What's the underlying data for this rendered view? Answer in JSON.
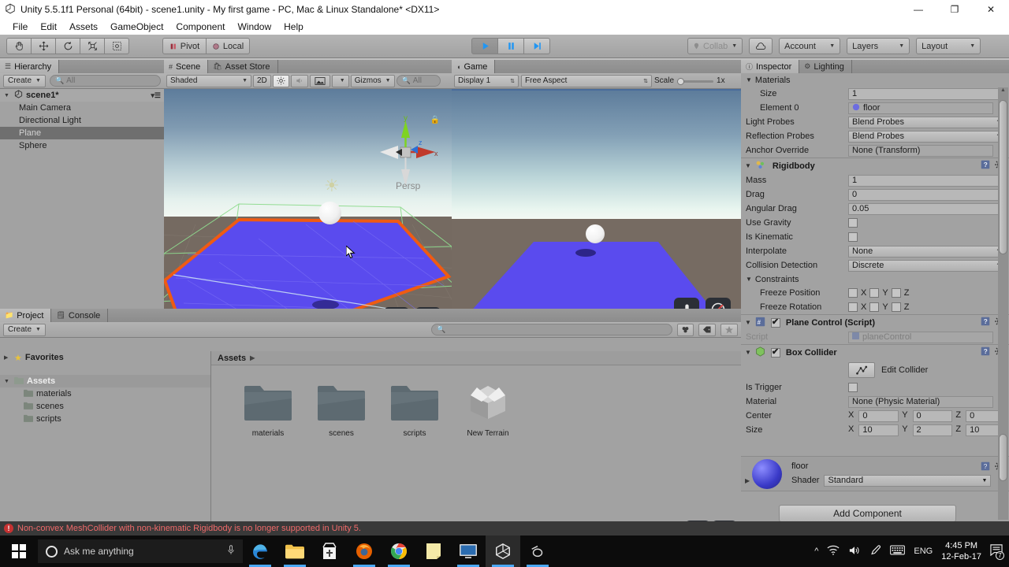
{
  "window": {
    "title": "Unity 5.5.1f1 Personal (64bit) - scene1.unity - My first game - PC, Mac & Linux Standalone* <DX11>",
    "app_icon": "unity-icon",
    "minimize": "—",
    "maximize": "❐",
    "close": "✕"
  },
  "menu": {
    "items": [
      "File",
      "Edit",
      "Assets",
      "GameObject",
      "Component",
      "Window",
      "Help"
    ]
  },
  "toolbar": {
    "transform_tools": [
      "hand-tool",
      "move-tool",
      "rotate-tool",
      "scale-tool",
      "rect-tool"
    ],
    "pivot_label": "Pivot",
    "local_label": "Local",
    "play_label": "play-button",
    "pause_label": "pause-button",
    "step_label": "step-button",
    "collab_label": "Collab",
    "cloud_label": "cloud-icon",
    "account_label": "Account",
    "layers_label": "Layers",
    "layout_label": "Layout"
  },
  "hierarchy": {
    "tab_label": "Hierarchy",
    "create_label": "Create",
    "search_placeholder": "All",
    "scene_name": "scene1*",
    "items": [
      {
        "label": "Main Camera",
        "selected": false
      },
      {
        "label": "Directional Light",
        "selected": false
      },
      {
        "label": "Plane",
        "selected": true
      },
      {
        "label": "Sphere",
        "selected": false
      }
    ]
  },
  "scene_view": {
    "tabs": [
      {
        "label": "Scene",
        "icon": "grid-icon",
        "active": true
      },
      {
        "label": "Asset Store",
        "icon": "store-icon",
        "active": false
      }
    ],
    "shading_mode": "Shaded",
    "mode_2d": "2D",
    "lighting_toggle": "sun-icon",
    "audio_toggle": "speaker-icon",
    "effects_toggle": "image-icon",
    "gizmos_label": "Gizmos",
    "search_placeholder": "All",
    "gizmo_axes": {
      "y": "y",
      "z": "z",
      "x": "x"
    },
    "projection_label": "Persp"
  },
  "game_view": {
    "tab_label": "Game",
    "display_label": "Display 1",
    "aspect_label": "Free Aspect",
    "scale_label": "Scale",
    "scale_value": "1x"
  },
  "project": {
    "tabs": [
      {
        "label": "Project",
        "icon": "folder-icon",
        "active": true
      },
      {
        "label": "Console",
        "icon": "console-icon",
        "active": false
      }
    ],
    "create_label": "Create",
    "search_placeholder": "",
    "tree": [
      {
        "label": "Favorites",
        "type": "favorites",
        "expanded": false
      },
      {
        "label": "Assets",
        "type": "folder",
        "selected": true,
        "expanded": true
      },
      {
        "label": "materials",
        "type": "folder",
        "indent": 2
      },
      {
        "label": "scenes",
        "type": "folder",
        "indent": 2
      },
      {
        "label": "scripts",
        "type": "folder",
        "indent": 2
      }
    ],
    "breadcrumb": "Assets",
    "assets": [
      {
        "label": "materials",
        "type": "folder"
      },
      {
        "label": "scenes",
        "type": "folder"
      },
      {
        "label": "scripts",
        "type": "folder"
      },
      {
        "label": "New Terrain",
        "type": "package"
      }
    ]
  },
  "inspector": {
    "tabs": [
      {
        "label": "Inspector",
        "icon": "info-icon",
        "active": true
      },
      {
        "label": "Lighting",
        "icon": "lighting-icon",
        "active": false
      }
    ],
    "materials": {
      "header": "Materials",
      "size_label": "Size",
      "size_value": "1",
      "element_label": "Element 0",
      "element_value": "floor",
      "light_probes_label": "Light Probes",
      "light_probes_value": "Blend Probes",
      "reflection_probes_label": "Reflection Probes",
      "reflection_probes_value": "Blend Probes",
      "anchor_label": "Anchor Override",
      "anchor_value": "None (Transform)"
    },
    "rigidbody": {
      "header": "Rigidbody",
      "mass_label": "Mass",
      "mass_value": "1",
      "drag_label": "Drag",
      "drag_value": "0",
      "angular_drag_label": "Angular Drag",
      "angular_drag_value": "0.05",
      "use_gravity_label": "Use Gravity",
      "use_gravity_checked": false,
      "is_kinematic_label": "Is Kinematic",
      "is_kinematic_checked": false,
      "interpolate_label": "Interpolate",
      "interpolate_value": "None",
      "collision_label": "Collision Detection",
      "collision_value": "Discrete",
      "constraints_label": "Constraints",
      "freeze_position_label": "Freeze Position",
      "freeze_rotation_label": "Freeze Rotation",
      "axes": [
        "X",
        "Y",
        "Z"
      ]
    },
    "script_component": {
      "header": "Plane Control (Script)",
      "enabled": true,
      "script_label": "Script",
      "script_value": "planeControl"
    },
    "box_collider": {
      "header": "Box Collider",
      "enabled": true,
      "edit_collider_label": "Edit Collider",
      "is_trigger_label": "Is Trigger",
      "is_trigger_checked": false,
      "material_label": "Material",
      "material_value": "None (Physic Material)",
      "center_label": "Center",
      "center_x": "0",
      "center_y": "0",
      "center_z": "0",
      "size_label": "Size",
      "size_x": "10",
      "size_y": "2",
      "size_z": "10"
    },
    "material_preview": {
      "name": "floor",
      "shader_label": "Shader",
      "shader_value": "Standard"
    },
    "add_component_label": "Add Component"
  },
  "status_bar": {
    "message": "Non-convex MeshCollider with non-kinematic Rigidbody is no longer supported in Unity 5.",
    "icon": "error-icon"
  },
  "taskbar": {
    "start_icon": "windows-start-icon",
    "search_placeholder": "Ask me anything",
    "mic_icon": "microphone-icon",
    "apps": [
      {
        "name": "edge-icon",
        "active": false,
        "running": true
      },
      {
        "name": "file-explorer-icon",
        "active": false,
        "running": true
      },
      {
        "name": "store-icon",
        "active": false,
        "running": false
      },
      {
        "name": "firefox-icon",
        "active": false,
        "running": true
      },
      {
        "name": "chrome-icon",
        "active": false,
        "running": true
      },
      {
        "name": "notepad-icon",
        "active": false,
        "running": false
      },
      {
        "name": "remote-desktop-icon",
        "active": false,
        "running": true
      },
      {
        "name": "unity-icon",
        "active": true,
        "running": true
      },
      {
        "name": "blender-icon",
        "active": false,
        "running": true
      }
    ],
    "tray": {
      "chevron": "^",
      "wifi": "wifi-icon",
      "volume": "volume-icon",
      "pen": "pen-icon",
      "keyboard": "keyboard-icon",
      "language": "ENG",
      "time": "4:45 PM",
      "date": "12-Feb-17",
      "notifications": "7"
    }
  },
  "colors": {
    "accent_blue": "#4ba8f5",
    "selection_orange": "#ef5b13",
    "plane_blue": "#5a4bee",
    "error_red": "#f06a6a",
    "panel_gray": "#a2a2a2"
  }
}
